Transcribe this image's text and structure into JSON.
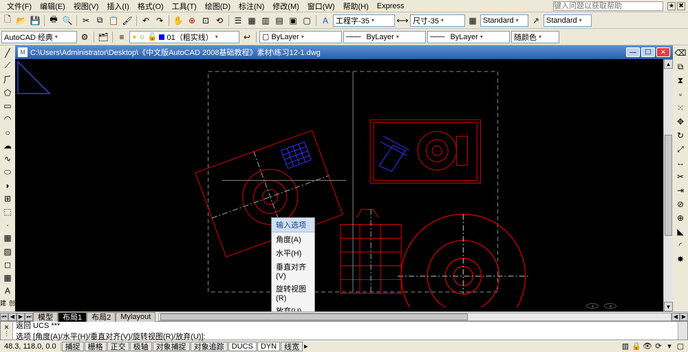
{
  "menu": {
    "items": [
      "文件(F)",
      "编辑(E)",
      "视图(V)",
      "插入(I)",
      "格式(O)",
      "工具(T)",
      "绘图(D)",
      "标注(N)",
      "修改(M)",
      "窗口(W)",
      "帮助(H)",
      "Express"
    ],
    "help_placeholder": "键入问题以获取帮助"
  },
  "toolbar2": {
    "workspace": "AutoCAD 经典",
    "layer": "0",
    "layer_item": "01（粗实线）",
    "linetype1": "ByLayer",
    "linetype2": "ByLayer",
    "linetype3": "ByLayer",
    "color": "随颜色"
  },
  "toolbar1b": {
    "textstyle": "工程字-35",
    "dimstyle": "尺寸-35",
    "std1": "Standard",
    "std2": "Standard"
  },
  "document": {
    "title": "C:\\Users\\Administrator\\Desktop\\《中文版AutoCAD 2008基础教程》素材\\练习12-1.dwg"
  },
  "context_menu": {
    "header": "输入选项",
    "items": [
      "角度(A)",
      "水平(H)",
      "垂直对齐(V)",
      "旋转视图(R)",
      "放弃(U)"
    ]
  },
  "tabs": {
    "items": [
      "模型",
      "布局1",
      "布局2",
      "Mylayout"
    ],
    "active": 1
  },
  "command": {
    "line1": "返回 UCS ***",
    "line2": "选项 [角度(A)/水平(H)/垂直对齐(V)/旋转视图(R)/放弃(U)]:"
  },
  "status": {
    "coords": "48.3, 118.0, 0.0",
    "buttons": [
      "捕捉",
      "栅格",
      "正交",
      "极轴",
      "对象捕捉",
      "对象追踪",
      "DUCS",
      "DYN",
      "线宽"
    ]
  }
}
